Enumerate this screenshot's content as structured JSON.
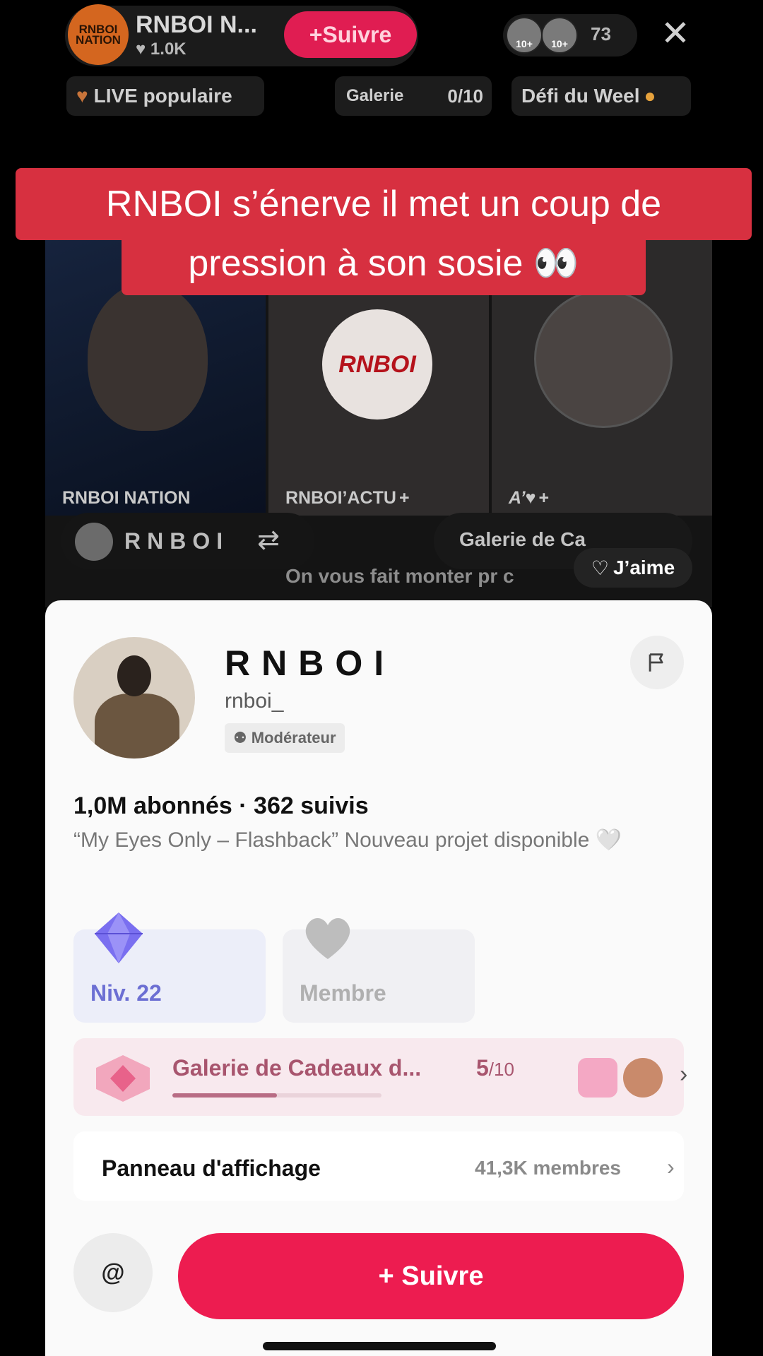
{
  "header": {
    "host_name": "RNBOI N...",
    "host_avatar_text": "RNBOI NATION",
    "host_likes": "1.0K",
    "follow_label": "Suivre",
    "viewer_badges": [
      "10+",
      "10+"
    ],
    "viewer_count": "73"
  },
  "chips": {
    "live_popular": "LIVE populaire",
    "gallery_label": "Galerie",
    "gallery_count": "0/10",
    "weekend_challenge": "Défi du Weel"
  },
  "caption": {
    "line1": "RNBOI s’énerve il met un coup de",
    "line2": "pression à son sosie 👀"
  },
  "video": {
    "tiles": [
      {
        "label": "RNBOI NATION",
        "plus": ""
      },
      {
        "label": "RNBOI’ACTU",
        "plus": "+",
        "logo_text": "RNBOI"
      },
      {
        "label": "A’♥",
        "plus": "+"
      }
    ],
    "host_name": "RNBOI",
    "swap_icon": "⇄",
    "gallery_pill": "Galerie de Ca",
    "like_label": "J’aime",
    "comment": "On vous fait monter pr c"
  },
  "profile": {
    "display_name": "RNBOI",
    "handle": "rnboi_",
    "role_badge": "Modérateur",
    "stats": "1,0M abonnés · 362 suivis",
    "bio": "“My Eyes Only – Flashback” Nouveau projet disponible 🤍",
    "level_label": "Niv. 22",
    "member_label": "Membre",
    "gallery_title": "Galerie de Cadeaux d...",
    "gallery_progress_num": "5",
    "gallery_progress_den": "/10",
    "gallery_progress_fraction": 0.5,
    "board_title": "Panneau d'affichage",
    "board_members": "41,3K  membres",
    "mention_icon": "@",
    "follow_label": "+ Suivre"
  },
  "colors": {
    "accent_pink": "#ed1c50",
    "caption_red": "#d73040",
    "level_purple": "#6c6fd3",
    "gallery_rose": "#a8556e"
  }
}
